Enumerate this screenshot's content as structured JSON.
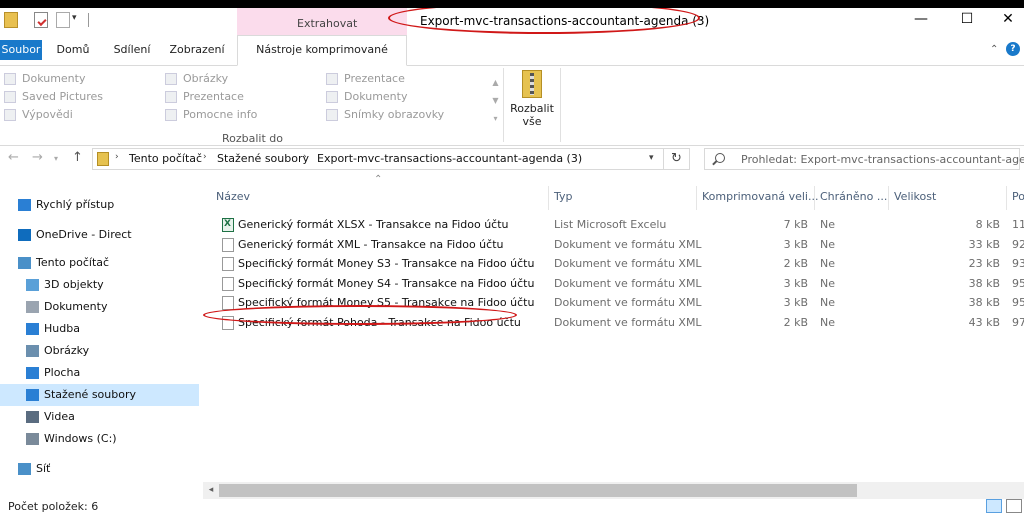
{
  "titlebar": {
    "context_group": "Extrahovat",
    "title": "Export-mvc-transactions-accountant-agenda (3)",
    "qat_dropdown": "▾",
    "minimize": "—",
    "maximize": "☐",
    "close": "✕"
  },
  "tabs": {
    "file": "Soubor",
    "home": "Domů",
    "share": "Sdílení",
    "view": "Zobrazení",
    "tools": "Nástroje komprimované složky",
    "collapse": "⌃",
    "help": "?"
  },
  "ribbon": {
    "destinations": [
      [
        "Dokumenty",
        "Saved Pictures",
        "Výpovědi"
      ],
      [
        "Obrázky",
        "Prezentace",
        "Pomocne info"
      ],
      [
        "Prezentace",
        "Dokumenty",
        "Snímky obrazovky"
      ]
    ],
    "group_label": "Rozbalit do",
    "extract_all_line1": "Rozbalit",
    "extract_all_line2": "vše",
    "scroll_up": "▲",
    "scroll_down": "▼",
    "scroll_more": "▾"
  },
  "navbar": {
    "back": "←",
    "forward": "→",
    "recent": "▾",
    "up": "↑",
    "breadcrumbs": [
      "Tento počítač",
      "Stažené soubory",
      "Export-mvc-transactions-accountant-agenda (3)"
    ],
    "crumb_sep": "›",
    "dropdown": "▾",
    "refresh": "↻",
    "search_placeholder": "Prohledat: Export-mvc-transactions-accountant-agend..."
  },
  "navpane": {
    "items": [
      {
        "label": "Rychlý přístup",
        "icon": "star-icon",
        "color": "#2a7fd4"
      },
      {
        "label": "OneDrive - Direct",
        "icon": "cloud-icon",
        "color": "#0f6cbd"
      },
      {
        "label": "Tento počítač",
        "icon": "computer-icon",
        "color": "#4a90c8"
      },
      {
        "label": "3D objekty",
        "icon": "cube-icon",
        "color": "#5aa0d8"
      },
      {
        "label": "Dokumenty",
        "icon": "document-icon",
        "color": "#9aa4b0"
      },
      {
        "label": "Hudba",
        "icon": "music-note-icon",
        "color": "#2a7fd4"
      },
      {
        "label": "Obrázky",
        "icon": "picture-icon",
        "color": "#6b8fae"
      },
      {
        "label": "Plocha",
        "icon": "desktop-icon",
        "color": "#2a7fd4"
      },
      {
        "label": "Stažené soubory",
        "icon": "download-arrow-icon",
        "color": "#2a7fd4"
      },
      {
        "label": "Videa",
        "icon": "film-icon",
        "color": "#5a6c80"
      },
      {
        "label": "Windows (C:)",
        "icon": "drive-icon",
        "color": "#7a8a9a"
      },
      {
        "label": "Síť",
        "icon": "network-icon",
        "color": "#4a90c8"
      }
    ],
    "selected": "Stažené soubory"
  },
  "filelist": {
    "sort_indicator": "⌃",
    "columns": [
      "Název",
      "Typ",
      "Komprimovaná veli...",
      "Chráněno ...",
      "Velikost",
      "Po"
    ],
    "rows": [
      {
        "name": "Generický formát XLSX - Transakce na Fidoo účtu",
        "icon": "excel-file-icon",
        "type": "List Microsoft Excelu",
        "compressed": "7 kB",
        "protected": "Ne",
        "size": "8 kB",
        "ratio": "11"
      },
      {
        "name": "Generický formát XML - Transakce na Fidoo účtu",
        "icon": "xml-file-icon",
        "type": "Dokument ve formátu XML",
        "compressed": "3 kB",
        "protected": "Ne",
        "size": "33 kB",
        "ratio": "92"
      },
      {
        "name": "Specifický formát Money S3 - Transakce na Fidoo účtu",
        "icon": "xml-file-icon",
        "type": "Dokument ve formátu XML",
        "compressed": "2 kB",
        "protected": "Ne",
        "size": "23 kB",
        "ratio": "93"
      },
      {
        "name": "Specifický formát Money S4 - Transakce na Fidoo účtu",
        "icon": "xml-file-icon",
        "type": "Dokument ve formátu XML",
        "compressed": "3 kB",
        "protected": "Ne",
        "size": "38 kB",
        "ratio": "95"
      },
      {
        "name": "Specifický formát Money S5 - Transakce na Fidoo účtu",
        "icon": "xml-file-icon",
        "type": "Dokument ve formátu XML",
        "compressed": "3 kB",
        "protected": "Ne",
        "size": "38 kB",
        "ratio": "95"
      },
      {
        "name": "Specifický formát Pohoda - Transakce na Fidoo účtu",
        "icon": "xml-file-icon",
        "type": "Dokument ve formátu XML",
        "compressed": "2 kB",
        "protected": "Ne",
        "size": "43 kB",
        "ratio": "97"
      }
    ]
  },
  "hscroll": {
    "left_arrow": "◂"
  },
  "status": {
    "item_count": "Počet položek: 6"
  },
  "colors": {
    "accent": "#1979ca",
    "context_tab": "#fbdcec",
    "selection": "#cde8ff",
    "annotation": "#d01818"
  }
}
